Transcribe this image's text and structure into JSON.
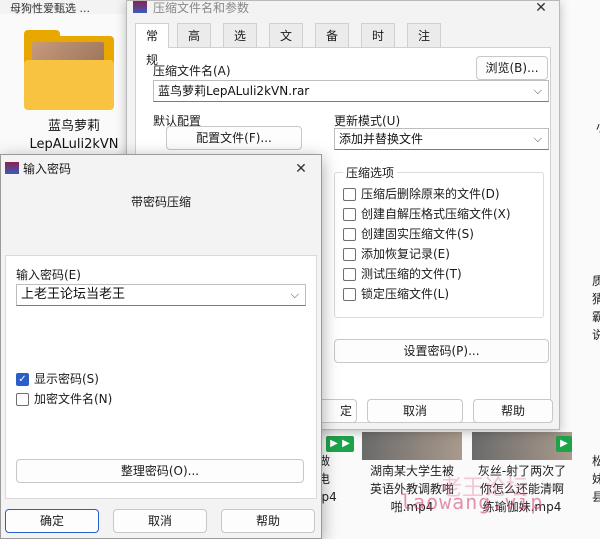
{
  "explorer": {
    "folder_top_text": "母狗性爱甄选 ...",
    "folder_label_line1": "蓝鸟萝莉",
    "folder_label_line2": "LepALuli2kVN",
    "videos": [
      {
        "label_line1": "湖南某大学生被",
        "label_line2": "英语外教调教啪",
        "label_line3": "啪.mp4"
      },
      {
        "label_line1": "灰丝-射了两次了",
        "label_line2": "你怎么还能清啊",
        "label_line3": "练瑜伽妹.mp4"
      }
    ],
    "partial_left_line1": "阻做",
    "partial_left_line2": "打电",
    "partial_left_line3": ".mp4",
    "side_texts": [
      "小",
      "质",
      "猜",
      "霸",
      "说",
      "松",
      "妹",
      "县"
    ],
    "watermark": "laowang.vip",
    "watermark_cn": "老王论坛"
  },
  "archive": {
    "title": "压缩文件名和参数",
    "tabs": [
      "常规",
      "高级",
      "选项",
      "文件",
      "备份",
      "时间",
      "注释"
    ],
    "filename_label": "压缩文件名(A)",
    "filename_value": "蓝鸟萝莉LepALuli2kVN.rar",
    "browse_button": "浏览(B)...",
    "default_config_label": "默认配置",
    "profiles_button": "配置文件(F)...",
    "update_mode_label": "更新模式(U)",
    "update_mode_value": "添加并替换文件",
    "options_group_title": "压缩选项",
    "options": [
      {
        "label": "压缩后删除原来的文件(D)",
        "checked": false
      },
      {
        "label": "创建自解压格式压缩文件(X)",
        "checked": false
      },
      {
        "label": "创建固实压缩文件(S)",
        "checked": false
      },
      {
        "label": "添加恢复记录(E)",
        "checked": false
      },
      {
        "label": "测试压缩的文件(T)",
        "checked": false
      },
      {
        "label": "锁定压缩文件(L)",
        "checked": false
      }
    ],
    "set_password_button": "设置密码(P)...",
    "ok_partial": "定",
    "cancel_button": "取消",
    "help_button": "帮助"
  },
  "password_dialog": {
    "title": "输入密码",
    "heading": "带密码压缩",
    "password_label": "输入密码(E)",
    "password_value": "上老王论坛当老王",
    "show_password_label": "显示密码(S)",
    "show_password_checked": true,
    "encrypt_names_label": "加密文件名(N)",
    "encrypt_names_checked": false,
    "organize_button": "整理密码(O)...",
    "ok_button": "确定",
    "cancel_button": "取消",
    "help_button": "帮助"
  }
}
